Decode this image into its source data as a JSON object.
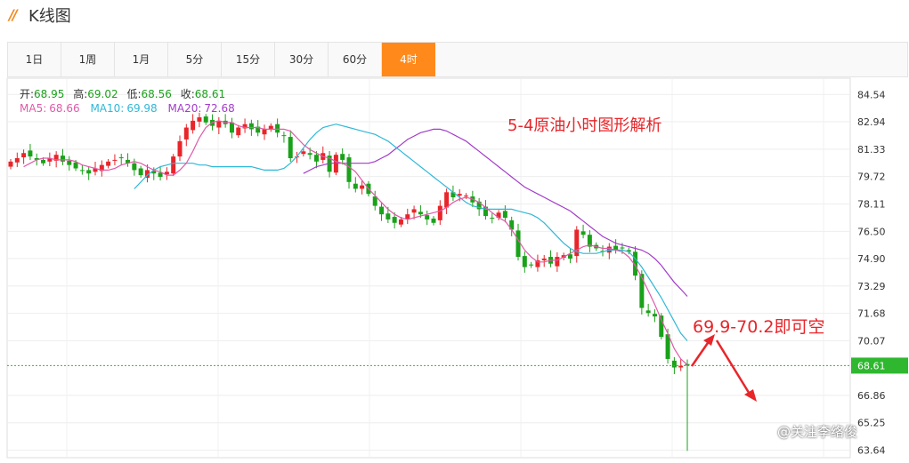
{
  "app": {
    "title": "K线图",
    "logo_icon": "double-slash-icon"
  },
  "tabs": [
    {
      "label": "1日",
      "active": false
    },
    {
      "label": "1周",
      "active": false
    },
    {
      "label": "1月",
      "active": false
    },
    {
      "label": "5分",
      "active": false
    },
    {
      "label": "15分",
      "active": false
    },
    {
      "label": "30分",
      "active": false
    },
    {
      "label": "60分",
      "active": false
    },
    {
      "label": "4时",
      "active": true
    }
  ],
  "ohlc_info": {
    "open_label": "开:",
    "open": "68.95",
    "high_label": "高:",
    "high": "69.02",
    "low_label": "低:",
    "low": "68.56",
    "close_label": "收:",
    "close": "68.61"
  },
  "ma_info": [
    {
      "label": "MA5:",
      "value": "68.66",
      "color": "#e05aa8"
    },
    {
      "label": "MA10:",
      "value": "69.98",
      "color": "#2fb8d8"
    },
    {
      "label": "MA20:",
      "value": "72.68",
      "color": "#a23cc8"
    }
  ],
  "annotations": {
    "chart_title": "5-4原油小时图形解析",
    "trade_note": "69.9-70.2即可空"
  },
  "watermark": "@关注李络俊",
  "colors": {
    "up": "#e8252a",
    "down": "#1aa11a",
    "accent": "#ff8a1b",
    "annotation": "#e8252a",
    "ma5": "#e05aa8",
    "ma10": "#2fb8d8",
    "ma20": "#a23cc8",
    "price_line": "#2fb82f"
  },
  "chart_data": {
    "type": "candlestick",
    "timeframe": "4时",
    "y_ticks": [
      "84.54",
      "82.94",
      "81.33",
      "79.72",
      "78.11",
      "76.50",
      "74.90",
      "73.29",
      "71.68",
      "70.07",
      "68.61",
      "66.86",
      "65.25",
      "63.64"
    ],
    "ylim": [
      63.2,
      85.5
    ],
    "last_price": "68.61",
    "grid": true,
    "close_series": [
      80.6,
      80.8,
      81.1,
      80.9,
      80.7,
      80.5,
      80.8,
      81.0,
      80.6,
      80.4,
      80.2,
      80.1,
      79.9,
      80.2,
      80.4,
      80.6,
      80.7,
      80.8,
      80.5,
      80.1,
      79.8,
      80.1,
      79.9,
      79.7,
      80.0,
      80.9,
      81.8,
      82.6,
      83.0,
      83.2,
      82.9,
      82.7,
      83.0,
      82.8,
      82.3,
      82.6,
      82.8,
      82.5,
      82.3,
      82.5,
      82.7,
      82.3,
      82.1,
      80.8,
      80.9,
      81.2,
      81.0,
      80.6,
      81.1,
      80.0,
      81.0,
      80.7,
      79.4,
      79.0,
      79.2,
      78.7,
      78.0,
      77.5,
      77.2,
      77.0,
      77.2,
      77.5,
      77.8,
      77.5,
      77.2,
      77.0,
      78.0,
      78.8,
      78.5,
      78.7,
      78.6,
      78.2,
      77.8,
      77.4,
      77.3,
      77.6,
      77.3,
      76.6,
      75.0,
      74.4,
      74.5,
      74.8,
      74.9,
      74.6,
      75.0,
      75.1,
      74.9,
      76.6,
      76.3,
      75.6,
      75.5,
      75.3,
      75.6,
      75.4,
      75.5,
      75.3,
      73.9,
      72.0,
      71.7,
      71.5,
      70.3,
      69.0,
      68.5,
      68.6,
      68.61
    ],
    "ma5": [
      80.3,
      80.5,
      80.7,
      80.8,
      80.8,
      80.7,
      80.7,
      80.7,
      80.6,
      80.4,
      80.3,
      80.2,
      80.1,
      80.1,
      80.2,
      80.4,
      80.5,
      80.6,
      80.5,
      80.3,
      80.1,
      80.0,
      79.8,
      79.8,
      80.1,
      80.5,
      81.2,
      82.0,
      82.6,
      82.9,
      83.0,
      82.9,
      82.9,
      82.7,
      82.6,
      82.6,
      82.6,
      82.5,
      82.5,
      82.5,
      82.5,
      82.4,
      82.0,
      81.6,
      81.3,
      81.1,
      80.9,
      80.8,
      80.6,
      80.5,
      80.3,
      80.0,
      79.5,
      79.0,
      78.6,
      78.2,
      77.8,
      77.5,
      77.3,
      77.2,
      77.3,
      77.4,
      77.5,
      77.6,
      77.7,
      77.9,
      78.2,
      78.4,
      78.5,
      78.4,
      78.2,
      77.9,
      77.6,
      77.3,
      77.1,
      76.6,
      76.0,
      75.4,
      75.0,
      74.7,
      74.7,
      74.8,
      74.8,
      75.0,
      75.2,
      75.4,
      75.6,
      75.7,
      75.6,
      75.5,
      75.5,
      75.4,
      75.3,
      75.0,
      74.5,
      73.8,
      73.0,
      72.2,
      71.3,
      70.5,
      69.6,
      69.0,
      68.66
    ],
    "ma10": [
      79.0,
      79.4,
      79.8,
      80.1,
      80.3,
      80.4,
      80.5,
      80.5,
      80.5,
      80.5,
      80.4,
      80.4,
      80.3,
      80.3,
      80.3,
      80.3,
      80.3,
      80.3,
      80.3,
      80.2,
      80.1,
      80.1,
      80.1,
      80.2,
      80.5,
      80.9,
      81.4,
      81.9,
      82.3,
      82.6,
      82.7,
      82.8,
      82.7,
      82.6,
      82.5,
      82.4,
      82.3,
      82.2,
      82.0,
      81.8,
      81.5,
      81.2,
      80.9,
      80.6,
      80.3,
      80.0,
      79.7,
      79.4,
      79.1,
      78.8,
      78.5,
      78.2,
      78.0,
      77.9,
      77.8,
      77.8,
      77.8,
      77.8,
      77.8,
      77.7,
      77.6,
      77.5,
      77.3,
      77.0,
      76.6,
      76.2,
      75.8,
      75.5,
      75.3,
      75.2,
      75.2,
      75.2,
      75.3,
      75.4,
      75.4,
      75.4,
      75.3,
      74.9,
      74.4,
      73.8,
      73.2,
      72.6,
      71.9,
      71.2,
      70.5,
      70.07
    ],
    "ma20": [
      79.9,
      80.1,
      80.3,
      80.4,
      80.5,
      80.5,
      80.5,
      80.5,
      80.5,
      80.5,
      80.5,
      80.6,
      80.8,
      81.0,
      81.3,
      81.6,
      81.9,
      82.1,
      82.3,
      82.4,
      82.5,
      82.5,
      82.4,
      82.2,
      82.0,
      81.8,
      81.5,
      81.2,
      80.9,
      80.6,
      80.3,
      80.0,
      79.7,
      79.4,
      79.1,
      78.9,
      78.7,
      78.5,
      78.3,
      78.1,
      77.9,
      77.7,
      77.4,
      77.1,
      76.8,
      76.5,
      76.2,
      76.0,
      75.8,
      75.7,
      75.6,
      75.5,
      75.4,
      75.2,
      74.9,
      74.5,
      74.0,
      73.5,
      73.1,
      72.68
    ]
  }
}
